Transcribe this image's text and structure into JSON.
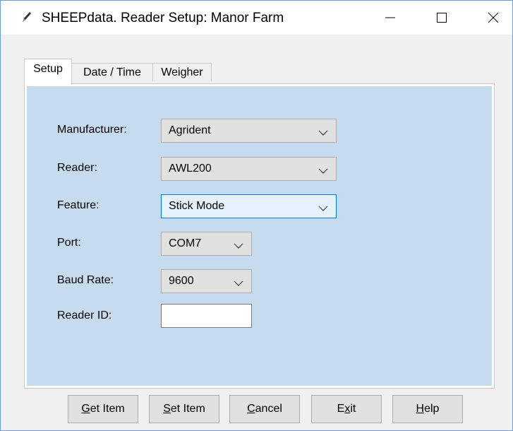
{
  "window": {
    "title": "SHEEPdata. Reader Setup: Manor Farm",
    "icon": "pencil-icon",
    "controls": [
      "minimize-icon",
      "maximize-icon",
      "close-icon"
    ]
  },
  "tabs": [
    {
      "label": "Setup",
      "active": true
    },
    {
      "label": "Date / Time",
      "active": false
    },
    {
      "label": "Weigher",
      "active": false
    }
  ],
  "form": {
    "manufacturer": {
      "label": "Manufacturer:",
      "value": "Agrident"
    },
    "reader": {
      "label": "Reader:",
      "value": "AWL200"
    },
    "feature": {
      "label": "Feature:",
      "value": "Stick Mode"
    },
    "port": {
      "label": "Port:",
      "value": "COM7"
    },
    "baud_rate": {
      "label": "Baud Rate:",
      "value": "9600"
    },
    "reader_id": {
      "label": "Reader ID:",
      "value": ""
    }
  },
  "buttons": {
    "get_item": {
      "mnemonic": "G",
      "rest": "et Item"
    },
    "set_item": {
      "mnemonic": "S",
      "rest": "et Item"
    },
    "cancel": {
      "mnemonic": "C",
      "rest": "ancel"
    },
    "exit": {
      "pre": "E",
      "mnemonic": "x",
      "rest": "it"
    },
    "help": {
      "mnemonic": "H",
      "rest": "elp"
    }
  },
  "colors": {
    "panel_background": "#c7dbef",
    "focus_border": "#0078d7"
  }
}
